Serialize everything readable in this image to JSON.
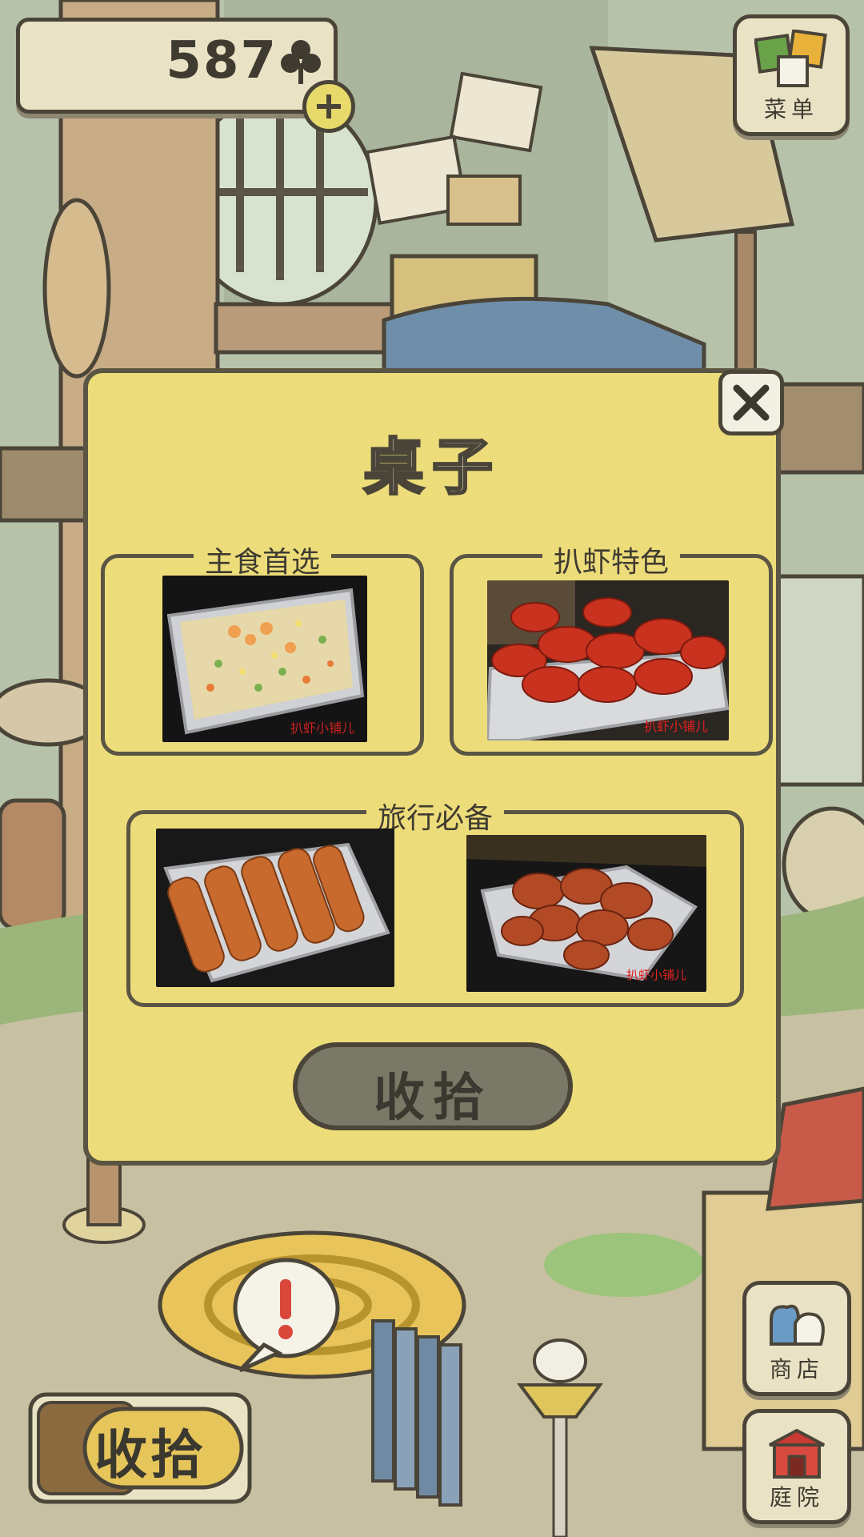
{
  "top_bar": {
    "clover_count": "587",
    "menu_label": "菜单"
  },
  "dialog": {
    "title": "桌子",
    "groups": [
      {
        "label": "主食首选",
        "items": [
          "fried-rice-photo"
        ]
      },
      {
        "label": "扒虾特色",
        "items": [
          "crayfish-photo"
        ]
      },
      {
        "label": "旅行必备",
        "items": [
          "mantis-shrimp-photo",
          "crab-photo"
        ]
      }
    ],
    "collect_label": "收拾"
  },
  "side_buttons": {
    "shop_label": "商店",
    "yard_label": "庭院"
  },
  "bottom": {
    "collect_label": "收拾"
  },
  "colors": {
    "dialog_bg": "#eddc7a",
    "button_gray": "#7a7866",
    "outline": "#4a4538"
  }
}
